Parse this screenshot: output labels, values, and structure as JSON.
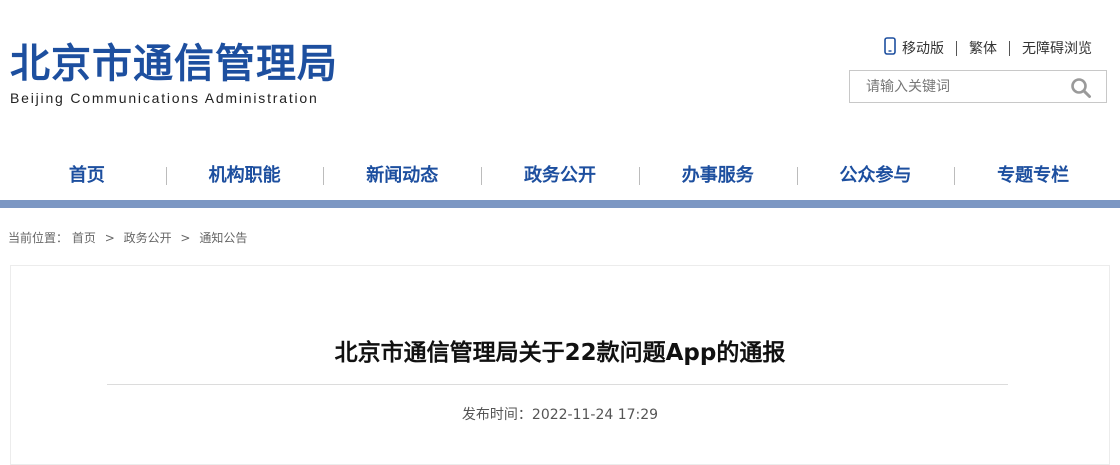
{
  "header": {
    "title": "北京市通信管理局",
    "subtitle": "Beijing Communications Administration",
    "links": {
      "mobile": "移动版",
      "traditional": "繁体",
      "accessible": "无障碍浏览"
    },
    "search": {
      "placeholder": "请输入关键词"
    }
  },
  "nav": {
    "items": [
      "首页",
      "机构职能",
      "新闻动态",
      "政务公开",
      "办事服务",
      "公众参与",
      "专题专栏"
    ]
  },
  "breadcrumb": {
    "label": "当前位置：",
    "items": [
      "首页",
      "政务公开",
      "通知公告"
    ],
    "separator": ">"
  },
  "article": {
    "title": "北京市通信管理局关于22款问题App的通报",
    "publish_label": "发布时间：",
    "publish_time": "2022-11-24 17:29"
  },
  "colors": {
    "brand": "#1d4f9f",
    "nav_bar": "#7c97c3"
  },
  "icons": {
    "mobile": "phone-icon",
    "search": "search-icon"
  }
}
